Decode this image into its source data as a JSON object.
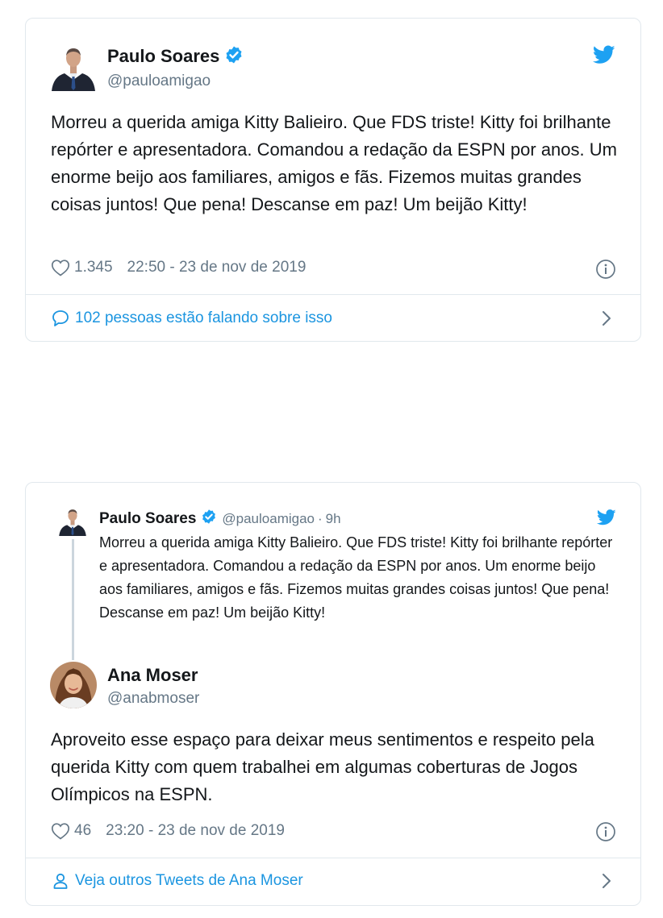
{
  "tweet1": {
    "author_name": "Paulo Soares",
    "author_handle": "@pauloamigao",
    "text": "Morreu a querida amiga Kitty Balieiro. Que FDS triste! Kitty foi brilhante repórter e apresentadora. Comandou a redação da ESPN por anos. Um enorme beijo aos familiares, amigos e fãs. Fizemos muitas grandes coisas juntos! Que pena! Descanse em paz! Um beijão Kitty!",
    "likes": "1.345",
    "timestamp": "22:50 - 23 de nov de 2019",
    "conversation_link": "102 pessoas estão falando sobre isso"
  },
  "tweet2": {
    "quoted": {
      "author_name": "Paulo Soares",
      "author_handle": "@pauloamigao",
      "separator": "·",
      "age": "9h",
      "text": "Morreu a querida amiga Kitty Balieiro. Que FDS triste! Kitty foi brilhante repórter e apresentadora. Comandou a redação da ESPN por anos. Um enorme beijo aos familiares, amigos e fãs. Fizemos muitas grandes coisas juntos! Que pena! Descanse em paz! Um beijão Kitty!"
    },
    "author_name": "Ana Moser",
    "author_handle": "@anabmoser",
    "text": "Aproveito esse espaço para deixar meus sentimentos e respeito pela querida Kitty com quem trabalhei em algumas coberturas de Jogos Olímpicos na ESPN.",
    "likes": "46",
    "timestamp": "23:20 - 23 de nov de 2019",
    "profile_link": "Veja outros Tweets de Ana Moser"
  },
  "colors": {
    "twitter_blue": "#1da1f2",
    "link_blue": "#1b95e0",
    "secondary_text": "#657786",
    "border": "#e1e8ed"
  },
  "icons": [
    "twitter-bird-icon",
    "verified-badge-icon",
    "heart-icon",
    "info-icon",
    "speech-bubble-icon",
    "person-icon",
    "chevron-right-icon"
  ]
}
